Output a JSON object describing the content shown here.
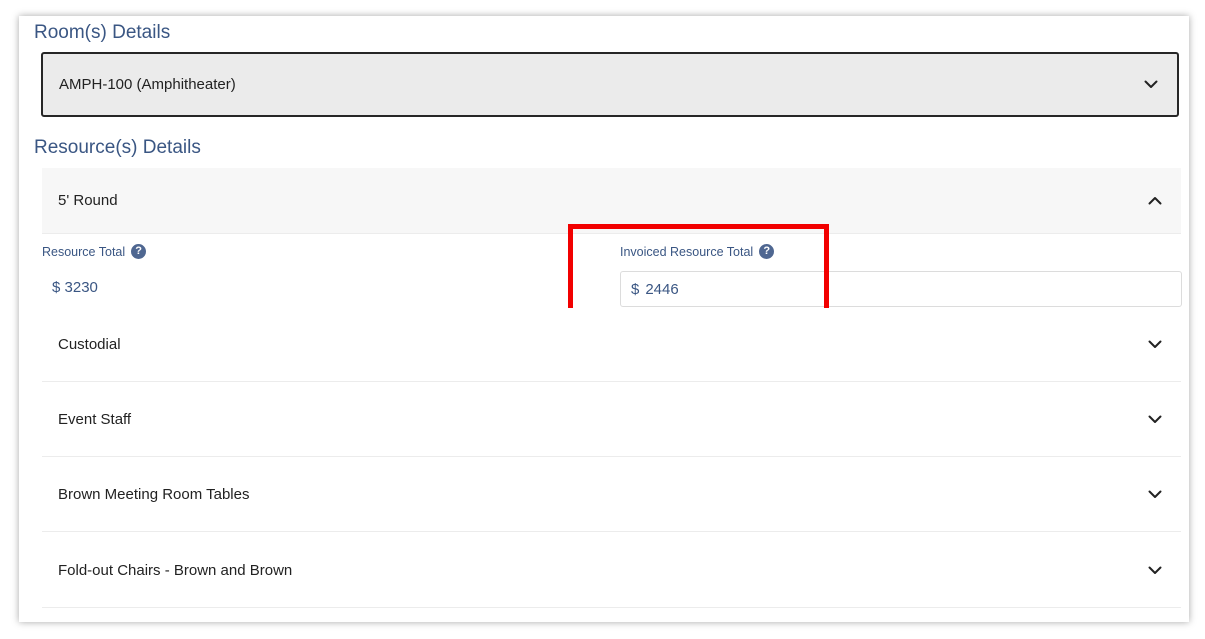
{
  "rooms_section": {
    "heading": "Room(s) Details",
    "items": [
      {
        "label": "AMPH-100 (Amphitheater)"
      }
    ]
  },
  "resources_section": {
    "heading": "Resource(s) Details",
    "expanded": {
      "label": "5' Round",
      "resource_total_label": "Resource Total",
      "resource_total_currency": "$",
      "resource_total_value": "3230",
      "invoiced_total_label": "Invoiced Resource Total",
      "invoiced_total_currency": "$",
      "invoiced_total_value": "2446",
      "help_icon_glyph": "?"
    },
    "collapsed": [
      {
        "label": "Custodial"
      },
      {
        "label": "Event Staff"
      },
      {
        "label": "Brown Meeting Room Tables"
      },
      {
        "label": "Fold-out Chairs - Brown and Brown"
      }
    ]
  },
  "icons": {
    "collapsed": "chevron-down-icon",
    "expanded": "chevron-up-icon",
    "help": "question-circle-icon"
  },
  "colors": {
    "heading": "#3a5683",
    "highlight": "#f20000",
    "room_bg": "#ebebeb",
    "help_icon_bg": "#4f6791"
  }
}
